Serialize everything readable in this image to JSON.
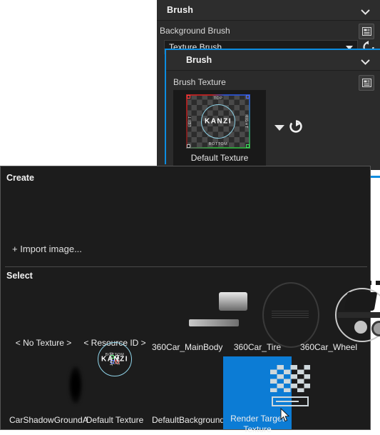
{
  "outer_panel": {
    "title": "Brush",
    "collapse_icon": "chevron-down-icon",
    "property_label": "Background Brush",
    "property_menu_icon": "property-menu-icon",
    "combo_value": "Texture Brush",
    "combo_arrow_icon": "caret-down-icon",
    "reset_icon": "reset-to-default-icon",
    "add_buttons": [
      "+",
      "+",
      "+",
      "+"
    ]
  },
  "inner_popup": {
    "title": "Brush",
    "collapse_icon": "chevron-down-icon",
    "property_label": "Brush Texture",
    "property_menu_icon": "property-menu-icon",
    "texture_name": "Default Texture",
    "dropdown_icon": "caret-down-icon",
    "goto_icon": "go-to-resource-icon",
    "thumbnail": {
      "top": "TOP",
      "bottom": "BOTTOM",
      "left": "LEFT",
      "right": "RIGHT",
      "center": "KANZI"
    }
  },
  "picker": {
    "create_title": "Create",
    "import_label": "+ Import image...",
    "select_title": "Select",
    "items": [
      {
        "label": "< No Texture >",
        "thumb": "none",
        "selected": false
      },
      {
        "label": "< Resource ID >",
        "thumb": "none",
        "selected": false
      },
      {
        "label": "360Car_MainBody",
        "thumb": "car-mainbody-thumb",
        "selected": false
      },
      {
        "label": "360Car_Tire",
        "thumb": "car-tire-thumb",
        "selected": false
      },
      {
        "label": "360Car_Wheel",
        "thumb": "car-wheel-thumb",
        "selected": false
      },
      {
        "label": "CarShadowGroundA",
        "thumb": "car-shadow-thumb",
        "selected": false
      },
      {
        "label": "Default Texture",
        "thumb": "kanzi-default-thumb",
        "selected": false
      },
      {
        "label": "DefaultBackground",
        "thumb": "default-background-thumb",
        "selected": false
      },
      {
        "label": "Render Target Texture",
        "thumb": "render-target-thumb",
        "selected": true
      }
    ]
  },
  "colors": {
    "accent": "#0c7cd5",
    "focus_border": "#0c8ce0",
    "panel_bg": "#2b2b2b",
    "dialog_bg": "#1c1c1c"
  },
  "cursor": {
    "icon": "mouse-pointer-icon"
  }
}
